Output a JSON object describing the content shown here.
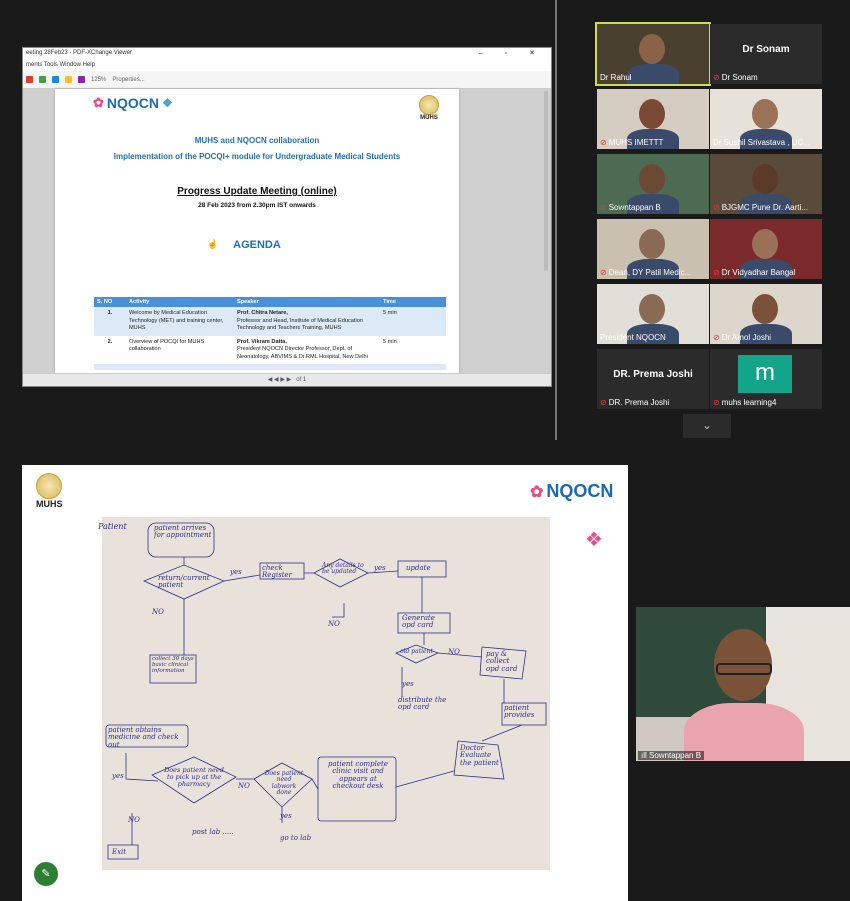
{
  "shared_window": {
    "title": "eeting 28Feb23 - PDF-XChange Viewer",
    "controls": "– ▫ ✕",
    "menu": "ments  Tools  Window  Help",
    "zoom": "125%",
    "properties_label": "Properties...",
    "page_indicator": "of 1"
  },
  "pdf": {
    "nqocn_logo": "NQOCN",
    "muhs_logo": "MUHS",
    "line1": "MUHS and NQOCN collaboration",
    "line2": "Implementation of the POCQI+ module for Undergraduate Medical Students",
    "meeting_title": "Progress Update Meeting (online)",
    "meeting_date": "28 Feb 2023 from 2.30pm IST onwards",
    "agenda_title": "AGENDA",
    "table_headers": [
      "S. NO",
      "Activity",
      "Speaker",
      "Time"
    ],
    "rows": [
      {
        "sno": "1.",
        "activity": "Welcome by Medical Education Technology (MET) and training center, MUHS",
        "speaker_name": "Prof. Chitra Netare,",
        "speaker_detail": "Professor and Head, Institute of Medical Education Technology and Teachers Training, MUHS",
        "time": "5 min"
      },
      {
        "sno": "2.",
        "activity": "Overview of POCQI for MUHS collaboration",
        "speaker_name": "Prof. Vikram Datta,",
        "speaker_detail": "President NQOCN Director Professor, Dept. of Neonatology, ABVIMS & Dr.RML Hospital, New Delhi",
        "time": "5 min"
      }
    ]
  },
  "participants": [
    {
      "name": "Dr Rahul",
      "big_name": "",
      "muted": false
    },
    {
      "name": "Dr Sonam",
      "big_name": "Dr Sonam",
      "muted": true
    },
    {
      "name": "MUHS IMETTT",
      "big_name": "",
      "muted": true
    },
    {
      "name": "Dr Sushil Srivastava , UC...",
      "big_name": "",
      "muted": false
    },
    {
      "name": "Sowntappan B",
      "big_name": "",
      "muted": true
    },
    {
      "name": "BJGMC Pune Dr. Aarti...",
      "big_name": "",
      "muted": true
    },
    {
      "name": "Dean, DY Patil Medic...",
      "big_name": "",
      "muted": true
    },
    {
      "name": "Dr Vidyadhar Bangal",
      "big_name": "",
      "muted": true
    },
    {
      "name": "President NQOCN",
      "big_name": "",
      "muted": false
    },
    {
      "name": "Dr Amol Joshi",
      "big_name": "",
      "muted": true
    },
    {
      "name": "DR. Prema Joshi",
      "big_name": "DR. Prema Joshi",
      "muted": true
    },
    {
      "name": "muhs learning4",
      "big_name": "m",
      "muted": true
    }
  ],
  "gallery_next_icon": "chevron-down",
  "share2": {
    "muhs_logo": "MUHS",
    "nqocn_logo": "NQOCN",
    "flowchart": {
      "patient_label": "Patient",
      "start": "patient arrives for appointment",
      "q_returning": "return/current patient",
      "yes1": "yes",
      "check_register": "check Register",
      "q_update": "Any details to be updated",
      "yes2": "yes",
      "update": "update",
      "no1": "NO",
      "collect_info": "collect 30 days basic clinical information",
      "no2": "NO",
      "generate_opd": "Generate opd card",
      "old_patient": "old patient",
      "no3": "NO",
      "pay_collect": "pay & collect opd card",
      "yes3": "yes",
      "distribute": "distribute the opd card",
      "provides": "patient provides",
      "doctor_eval": "Doctor Evaluate the patient",
      "complete_visit": "patient complete clinic visit and appears at checkout desk",
      "q_lab": "Does patient need labwork done",
      "no4": "NO",
      "yes4": "yes",
      "go_lab": "go to lab",
      "q_pharmacy": "Does patient need to pick up at the pharmacy",
      "yes5": "yes",
      "obtains": "patient obtains medicine and check out",
      "no5": "NO",
      "exit": "Exit",
      "post_lab": "post lab ....."
    }
  },
  "pip": {
    "name": "Sowntappan B"
  }
}
